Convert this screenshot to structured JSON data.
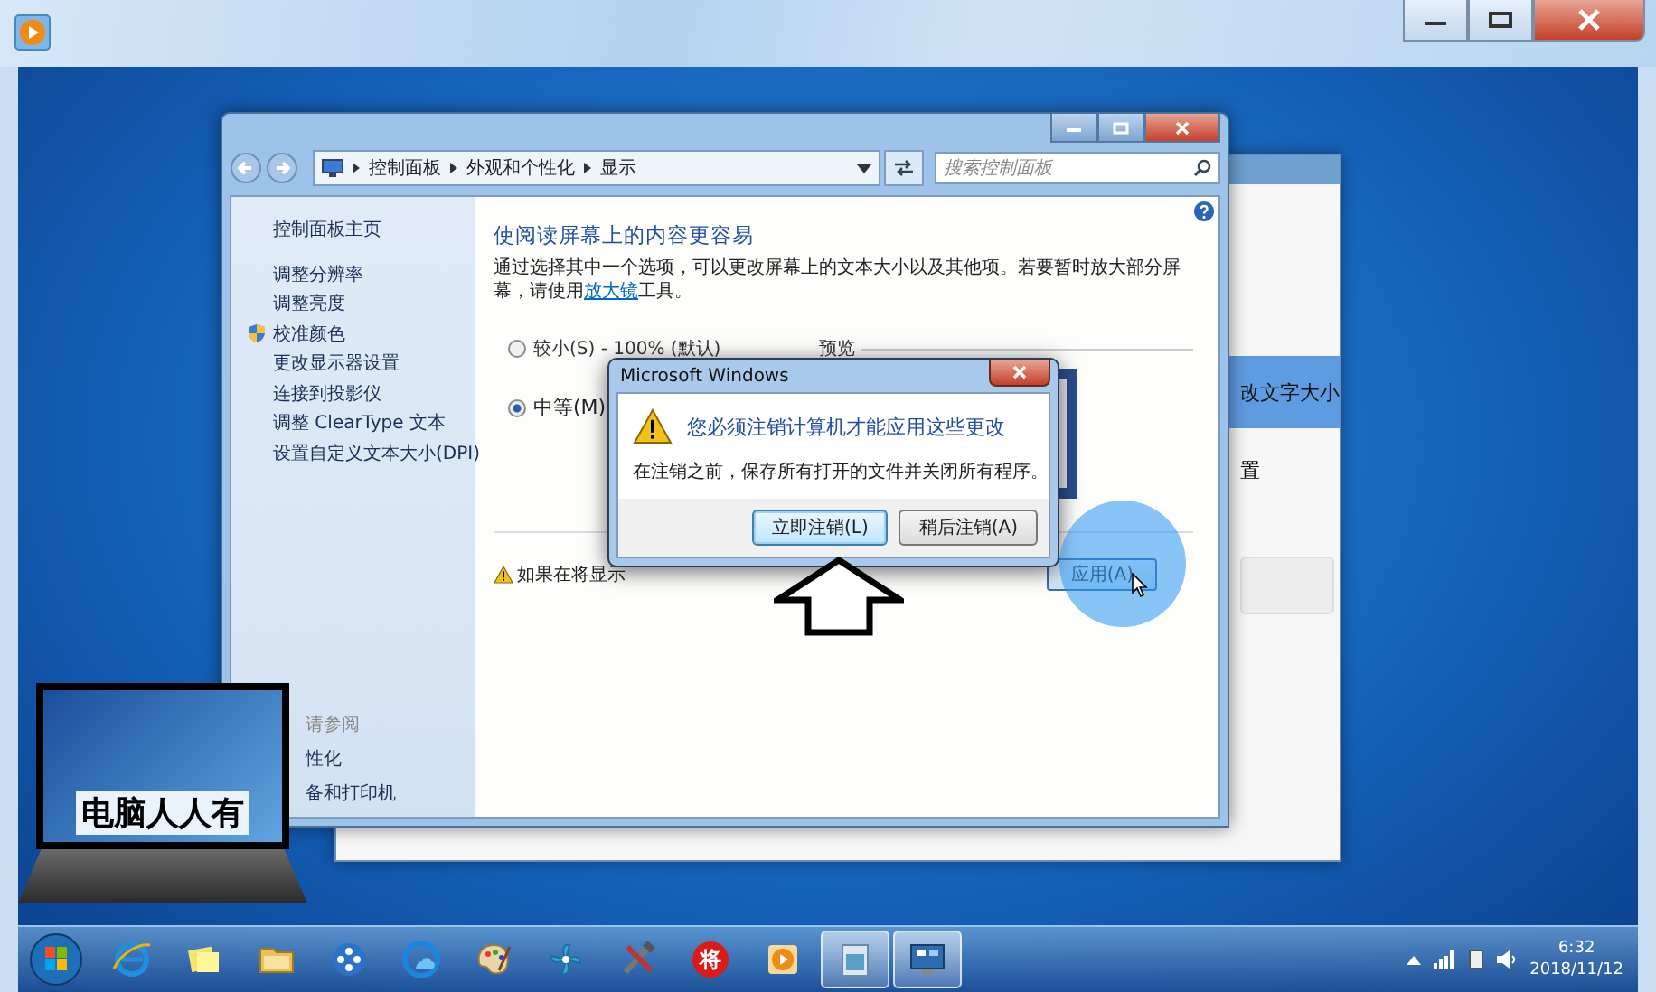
{
  "control_panel": {
    "breadcrumb": [
      "控制面板",
      "外观和个性化",
      "显示"
    ],
    "search": {
      "placeholder": "搜索控制面板"
    },
    "sidebar": {
      "items": [
        {
          "label": "控制面板主页",
          "shield": false
        },
        {
          "label": "调整分辨率",
          "shield": false
        },
        {
          "label": "调整亮度",
          "shield": false
        },
        {
          "label": "校准颜色",
          "shield": true
        },
        {
          "label": "更改显示器设置",
          "shield": false
        },
        {
          "label": "连接到投影仪",
          "shield": false
        },
        {
          "label": "调整 ClearType 文本",
          "shield": false
        },
        {
          "label": "设置自定义文本大小(DPI)",
          "shield": false
        }
      ],
      "see_also": {
        "heading": "请参阅",
        "items": [
          "性化",
          "备和打印机"
        ]
      }
    },
    "heading": "使阅读屏幕上的内容更容易",
    "description": {
      "before": "通过选择其中一个选项，可以更改屏幕上的文本大小以及其他项。若要暂时放大部分屏幕，请使用",
      "link": "放大镜",
      "after": "工具。"
    },
    "options": [
      {
        "label": "较小(S) - 100% (默认)",
        "selected": false
      },
      {
        "label": "中等(M)",
        "selected": true
      }
    ],
    "preview_label": "预览",
    "warning": "如果在将显示",
    "apply_button": "应用(A)"
  },
  "back_window": {
    "texts": [
      "改文字大小",
      "置"
    ]
  },
  "dialog": {
    "title": "Microsoft Windows",
    "heading": "您必须注销计算机才能应用这些更改",
    "message": "在注销之前，保存所有打开的文件并关闭所有程序。",
    "buttons": [
      {
        "label": "立即注销(L)",
        "default": true
      },
      {
        "label": "稍后注销(A)",
        "default": false
      }
    ]
  },
  "logo": {
    "text": "电脑人人有"
  },
  "taskbar": {
    "apps": [
      {
        "kind": "ie",
        "active": false
      },
      {
        "kind": "notes",
        "active": false
      },
      {
        "kind": "folder",
        "active": false
      },
      {
        "kind": "media",
        "active": false
      },
      {
        "kind": "cloud",
        "active": false
      },
      {
        "kind": "palette",
        "active": false
      },
      {
        "kind": "fan",
        "active": false
      },
      {
        "kind": "tools",
        "active": false
      },
      {
        "kind": "badge",
        "text": "将",
        "active": false
      },
      {
        "kind": "play",
        "active": false
      },
      {
        "kind": "window",
        "active": true
      },
      {
        "kind": "display",
        "active": true
      }
    ],
    "clock": {
      "time": "6:32",
      "date": "2018/11/12"
    }
  }
}
